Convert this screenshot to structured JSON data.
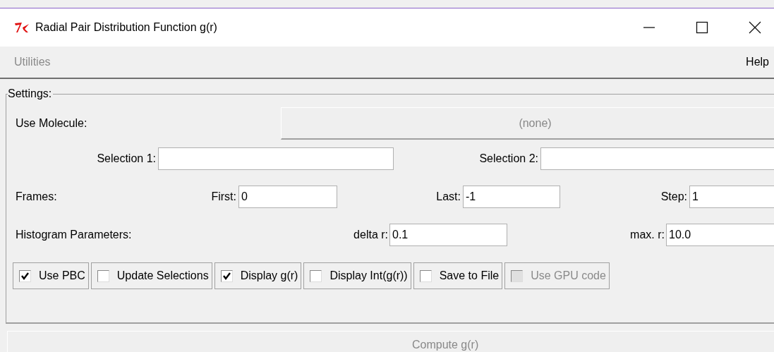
{
  "window": {
    "title": "Radial Pair Distribution Function g(r)"
  },
  "menu": [
    {
      "label": "Utilities",
      "disabled": true
    },
    {
      "label": "Help",
      "disabled": false
    }
  ],
  "settings": {
    "title": "Settings:",
    "molecule": {
      "label": "Use Molecule:",
      "value": "(none)",
      "disabled": true
    },
    "selections": [
      {
        "label": "Selection 1:"
      },
      {
        "label": "Selection 2:"
      }
    ],
    "frames": {
      "label": "Frames:",
      "fields": [
        {
          "label": "First:",
          "value": "0"
        },
        {
          "label": "Last:",
          "value": "-1"
        },
        {
          "label": "Step:",
          "value": "1"
        }
      ]
    },
    "histogram": {
      "label": "Histogram Parameters:",
      "fields": [
        {
          "label": "delta r:",
          "value": "0.1"
        },
        {
          "label": "max. r:",
          "value": "10.0"
        }
      ]
    },
    "options": [
      {
        "label": "Use PBC",
        "checked": true,
        "disabled": false
      },
      {
        "label": "Update Selections",
        "checked": false,
        "disabled": false
      },
      {
        "label": "Display g(r)",
        "checked": true,
        "disabled": false
      },
      {
        "label": "Display Int(g(r))",
        "checked": false,
        "disabled": false
      },
      {
        "label": "Save to File",
        "checked": false,
        "disabled": false
      },
      {
        "label": "Use GPU code",
        "checked": false,
        "disabled": true
      }
    ]
  },
  "compute_button": {
    "label": "Compute g(r)",
    "disabled": true
  }
}
